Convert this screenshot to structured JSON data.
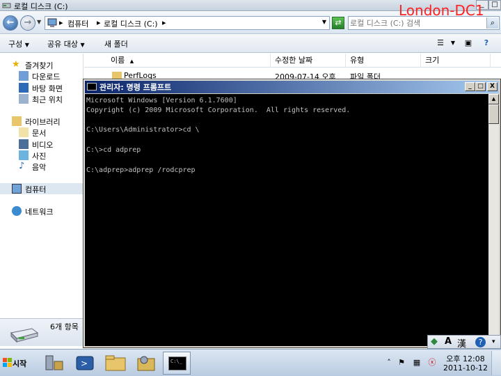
{
  "explorer": {
    "title": "로컬 디스크 (C:)",
    "window_buttons": {
      "minimize": "_",
      "restore": "□"
    },
    "breadcrumbs": [
      "컴퓨터",
      "로컬 디스크 (C:)"
    ],
    "search_placeholder": "로컬 디스크 (C:) 검색",
    "toolbar": {
      "organize": "구성",
      "share": "공유 대상",
      "new_folder": "새 폴더"
    },
    "nav": {
      "favorites": "즐겨찾기",
      "downloads": "다운로드",
      "desktop": "바탕 화면",
      "recent": "최근 위치",
      "libraries": "라이브러리",
      "documents": "문서",
      "videos": "비디오",
      "pictures": "사진",
      "music": "음악",
      "computer": "컴퓨터",
      "network": "네트워크"
    },
    "columns": [
      "이름",
      "수정한 날짜",
      "유형",
      "크기"
    ],
    "rows": [
      {
        "name": "PerfLogs",
        "date": "2009-07-14 오후",
        "type": "파일 폴더"
      }
    ],
    "details": {
      "item_count": "6개 항목"
    }
  },
  "watermark": "London-DC1",
  "cmd": {
    "title": "관리자: 명령 프롬프트",
    "lines": [
      "Microsoft Windows [Version 6.1.7600]",
      "Copyright (c) 2009 Microsoft Corporation.  All rights reserved.",
      "",
      "C:\\Users\\Administrator>cd \\",
      "",
      "C:\\>cd adprep",
      "",
      "C:\\adprep>adprep /rodcprep"
    ]
  },
  "ime": {
    "mode": "A",
    "hanja": "漢",
    "help": "?"
  },
  "taskbar": {
    "start_label": "시작",
    "cmd_icon_text": "C:\\_",
    "clock_time": "오후 12:08",
    "clock_date": "2011-10-12"
  },
  "colors": {
    "cmd_title_start": "#0a246a",
    "cmd_title_end": "#a6caf0",
    "console_bg": "#000000",
    "console_text": "#c0c0c0",
    "watermark": "#ff2020"
  }
}
